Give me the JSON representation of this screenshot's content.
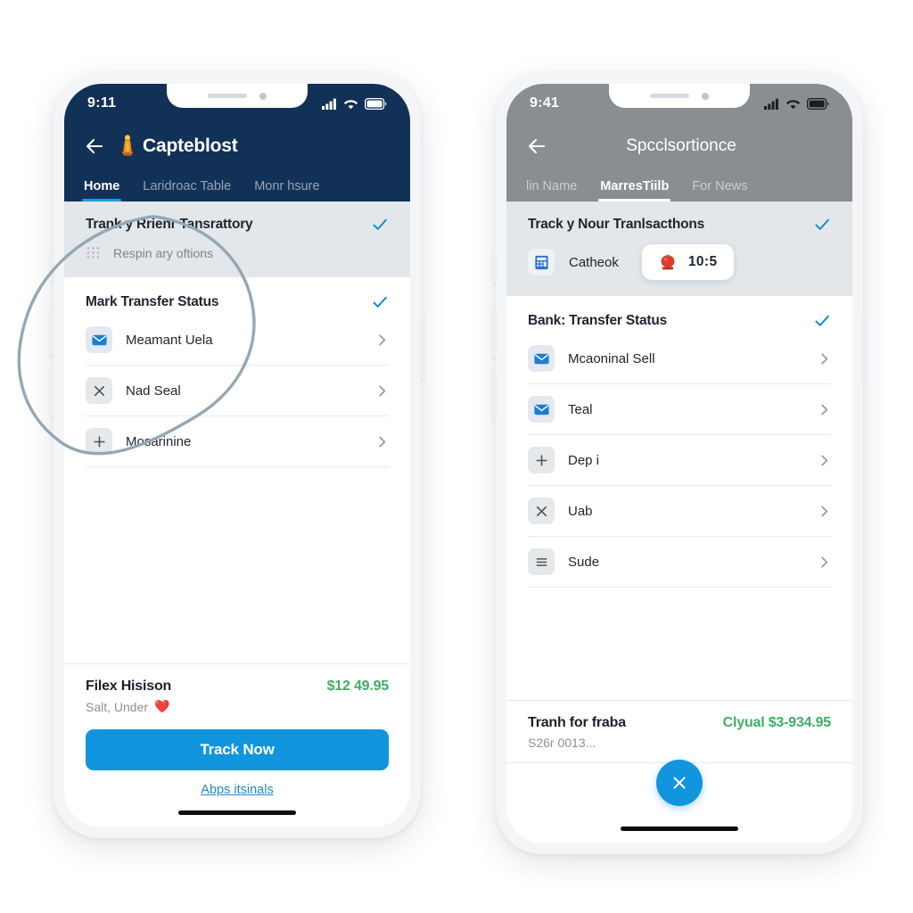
{
  "phones": {
    "left": {
      "status": {
        "time": "9:11",
        "icons": [
          "cellular-signal-icon",
          "wifi-icon",
          "battery-icon"
        ]
      },
      "appbar": {
        "back_icon": "back-arrow-icon",
        "logo_icon": "statue-logo-icon",
        "title": "Capteblost"
      },
      "tabs": [
        {
          "label": "Home",
          "active": true
        },
        {
          "label": "Laridroac Table",
          "active": false
        },
        {
          "label": "Monr hsure",
          "active": false
        }
      ],
      "highlight_section": {
        "title": "Trank y Rrienr Tansrattory",
        "check_icon": "check-icon",
        "sub_icon": "grid-dots-icon",
        "sub_label": "Respin ary oftions"
      },
      "list_section": {
        "title": "Mark Transfer Status",
        "check_icon": "check-icon",
        "items": [
          {
            "icon": "mail-icon",
            "label": "Meamant Uela",
            "chevron": "chevron-right-icon"
          },
          {
            "icon": "close-x-icon",
            "label": "Nad Seal",
            "chevron": "chevron-right-icon"
          },
          {
            "icon": "plus-icon",
            "label": "Mosarinine",
            "chevron": "chevron-right-icon"
          }
        ]
      },
      "footer": {
        "name": "Filex Hisison",
        "price": "$12 49.95",
        "sub": "Salt, Under",
        "heart_icon": "❤️",
        "cta_label": "Track Now",
        "link_label": "Abps itsinals"
      }
    },
    "right": {
      "status": {
        "time": "9:41",
        "icons": [
          "cellular-signal-icon",
          "wifi-icon",
          "battery-icon"
        ]
      },
      "appbar": {
        "back_icon": "back-arrow-icon",
        "title": "Spcclsortionce"
      },
      "tabs": [
        {
          "label": "lin Name",
          "active": false
        },
        {
          "label": "MarresTiilb",
          "active": true
        },
        {
          "label": "For News",
          "active": false
        }
      ],
      "highlight_section": {
        "title": "Track y Nour Tranlsacthons",
        "check_icon": "check-icon",
        "card": {
          "icon": "calculator-icon",
          "label": "Catheok",
          "pill": {
            "badge_icon": "tomato-timer-icon",
            "time": "10:5"
          }
        }
      },
      "list_section": {
        "title": "Bank: Transfer Status",
        "check_icon": "check-icon",
        "items": [
          {
            "icon": "mail-icon",
            "label": "Mcaoninal Sell",
            "chevron": "chevron-right-icon"
          },
          {
            "icon": "mail-icon",
            "label": "Teal",
            "chevron": "chevron-right-icon"
          },
          {
            "icon": "plus-icon",
            "label": "Dep i",
            "chevron": "chevron-right-icon"
          },
          {
            "icon": "close-x-icon",
            "label": "Uab",
            "chevron": "chevron-right-icon"
          },
          {
            "icon": "menu-lines-icon",
            "label": "Sude",
            "chevron": "chevron-right-icon"
          }
        ]
      },
      "footer": {
        "name": "Tranh for fraba",
        "price": "Clyual $3-934.95",
        "sub": "S26r 0013...",
        "fab_icon": "close-x-icon"
      }
    }
  },
  "annotation": {
    "shape": "hand-drawn-ellipse",
    "color": "#93a8b3"
  },
  "colors": {
    "nav_dark": "#123157",
    "nav_grey": "#8a8e93",
    "accent_blue": "#1195de",
    "price_green": "#3fae63",
    "grey_block": "#e3e7ea"
  }
}
